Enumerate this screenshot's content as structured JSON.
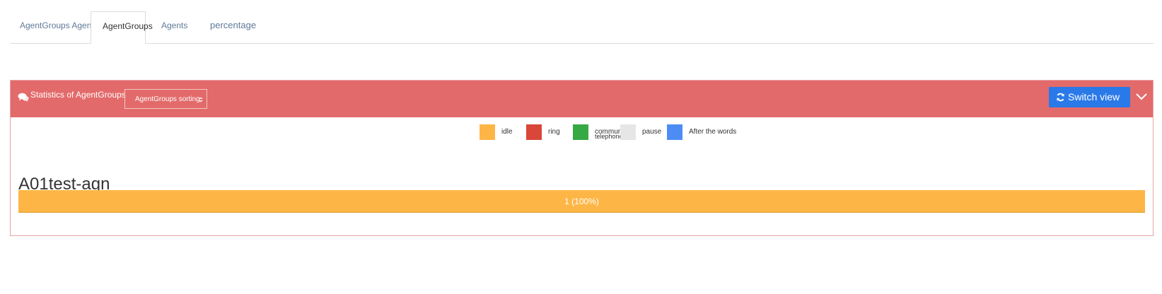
{
  "tabs": [
    {
      "label": "AgentGroups Agents",
      "active": false
    },
    {
      "label": "AgentGroups",
      "active": true
    },
    {
      "label": "Agents",
      "active": false
    },
    {
      "label": "percentage",
      "active": false
    }
  ],
  "panel": {
    "title": "Statistics of AgentGroups",
    "sort_label": "AgentGroups sorting",
    "switch_label": "Switch view",
    "header_color": "#e36a6a",
    "switch_color": "#2a79e8",
    "icons": {
      "title": "chat-icon",
      "switch": "refresh-icon",
      "collapse": "chevron-down-icon",
      "sort": "sort-icon"
    }
  },
  "legend": [
    {
      "label": "idle",
      "color": "#fdb646"
    },
    {
      "label": "ring",
      "color": "#d9473a"
    },
    {
      "label": "communicat",
      "sublabel": "telephone",
      "color": "#36a944"
    },
    {
      "label": "pause",
      "color": "#e6e6e6"
    },
    {
      "label": "After the words",
      "color": "#4d8cf5"
    }
  ],
  "groups": [
    {
      "name": "A01test-agn",
      "segments": [
        {
          "status": "idle",
          "count": 1,
          "percent": 100,
          "label": "1 (100%)",
          "color": "#fdb646"
        }
      ]
    }
  ]
}
